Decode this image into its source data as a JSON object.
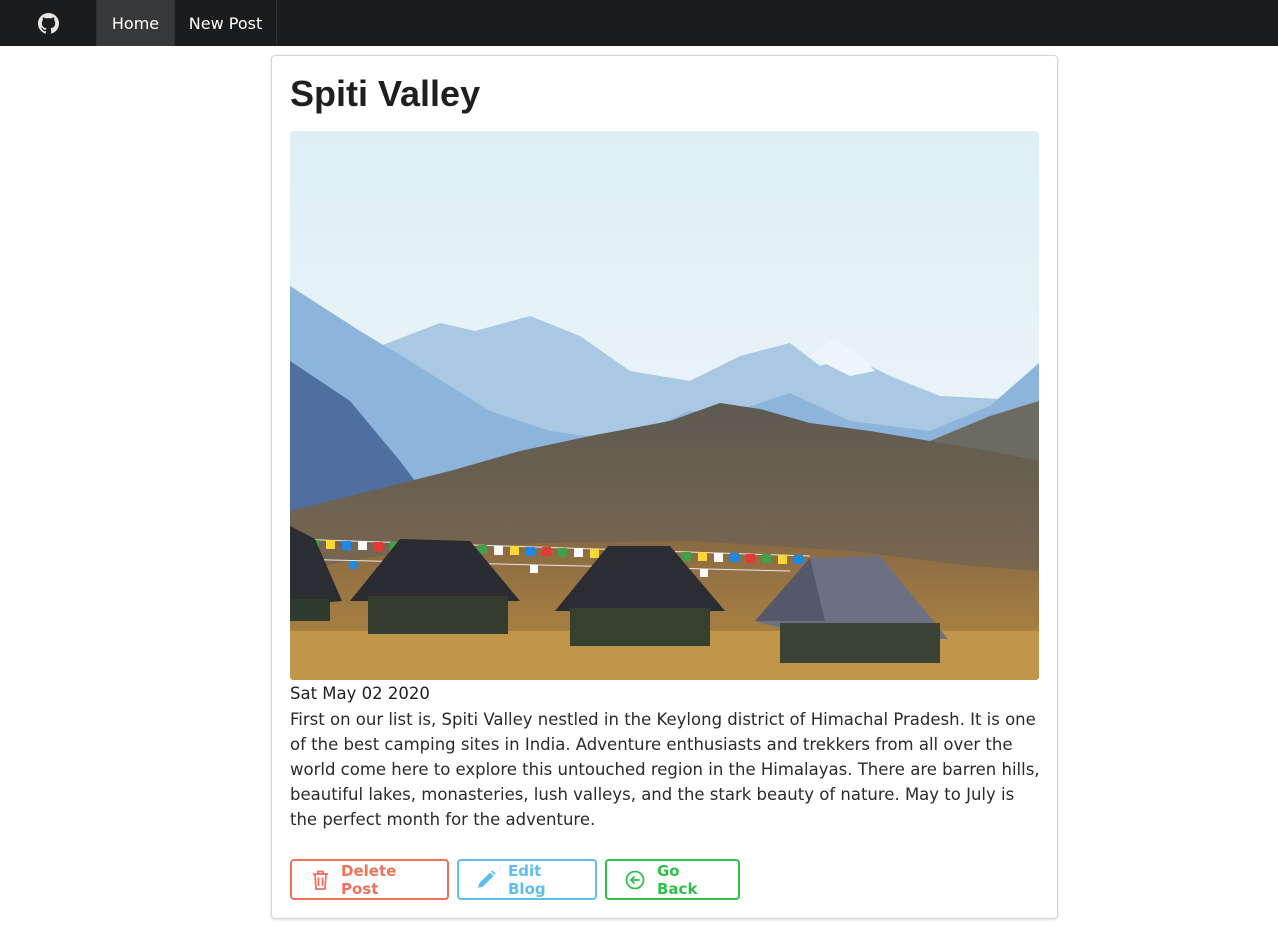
{
  "nav": {
    "logo_icon": "github-icon",
    "items": [
      {
        "label": "Home",
        "active": true
      },
      {
        "label": "New Post",
        "active": false
      }
    ]
  },
  "post": {
    "title": "Spiti Valley",
    "date": "Sat May 02 2020",
    "body": "First on our list is, Spiti Valley nestled in the Keylong district of Himachal Pradesh. It is one of the best camping sites in India. Adventure enthusiasts and trekkers from all over the world come here to explore this untouched region in the Himalayas. There are barren hills, beautiful lakes, monasteries, lush valleys, and the stark beauty of nature. May to July is the perfect month for the adventure."
  },
  "actions": {
    "delete": {
      "label": "Delete Post",
      "icon": "trash-icon",
      "color": "#f2715b"
    },
    "edit": {
      "label": "Edit Blog",
      "icon": "pencil-icon",
      "color": "#5cbfef"
    },
    "back": {
      "label": "Go Back",
      "icon": "arrow-circle-left-icon",
      "color": "#2fc04a"
    }
  },
  "colors": {
    "navbar": "#1b1c1d",
    "nav_active": "#373839"
  }
}
